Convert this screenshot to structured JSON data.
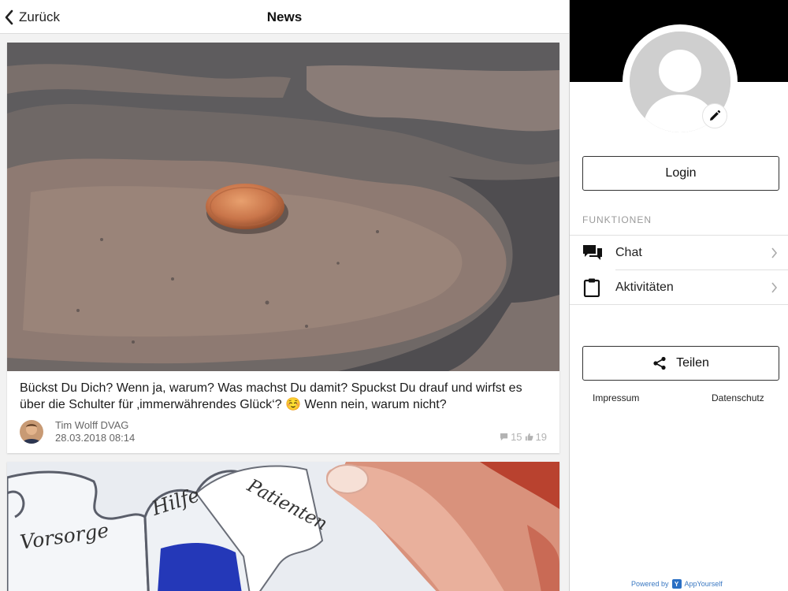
{
  "header": {
    "back_label": "Zurück",
    "title": "News"
  },
  "posts": [
    {
      "image_alt": "Kupfermünze auf Pflasterstein",
      "text": "Bückst Du Dich? Wenn ja, warum? Was machst Du damit? Spuckst Du drauf und wirfst es über die Schulter für ‚immerwährendes Glück‘? ☺️ Wenn nein, warum nicht?",
      "author": "Tim Wolff DVAG",
      "date": "28.03.2018 08:14",
      "comments": "15",
      "likes": "19"
    },
    {
      "image_alt": "Puzzleteile",
      "puzzle_words": [
        "Vorsorge",
        "Hilfe",
        "Patienten"
      ]
    }
  ],
  "side": {
    "login_label": "Login",
    "section_label": "FUNKTIONEN",
    "menu": [
      {
        "label": "Chat",
        "icon": "chat-icon"
      },
      {
        "label": "Aktivitäten",
        "icon": "clipboard-icon"
      }
    ],
    "share_label": "Teilen",
    "impressum": "Impressum",
    "datenschutz": "Datenschutz",
    "powered_by": "Powered by",
    "brand": "AppYourself",
    "brand_initial": "Y"
  },
  "colors": {
    "accent_link": "#3a78c2",
    "header_black": "#000000",
    "page_bg": "#f2f2f2"
  }
}
